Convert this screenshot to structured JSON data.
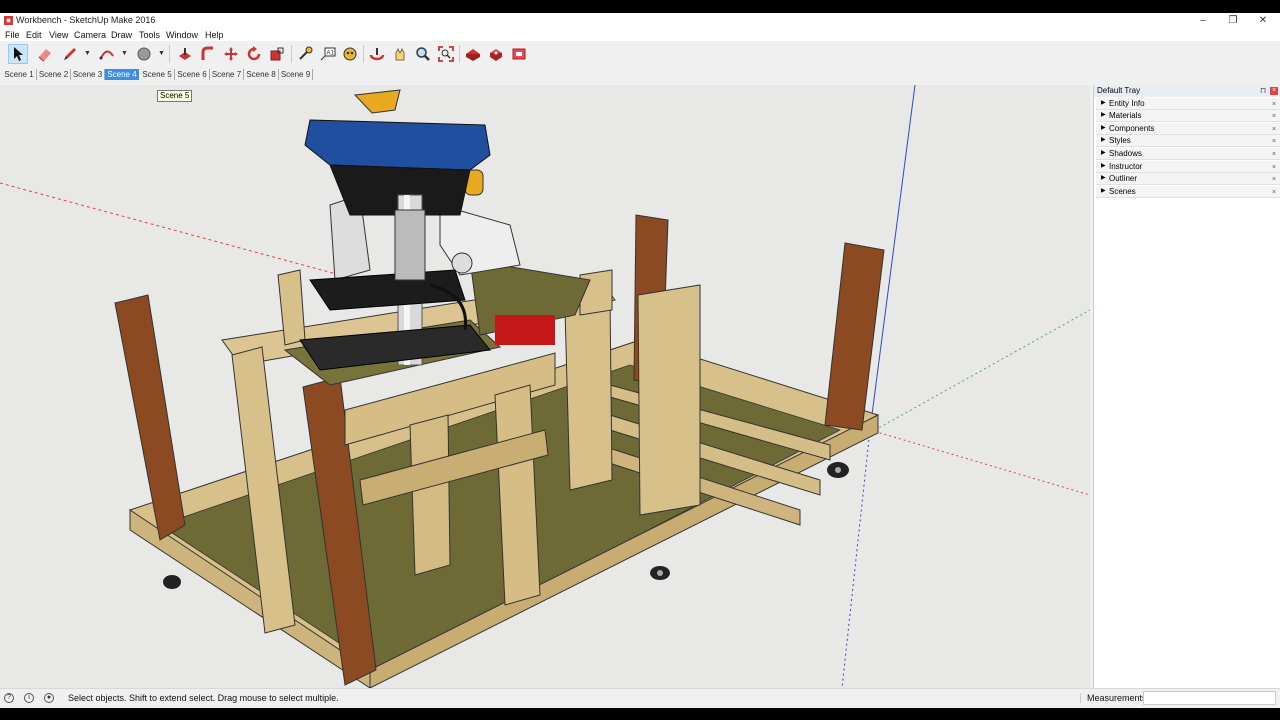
{
  "window": {
    "title": "Workbench - SketchUp Make 2016"
  },
  "menu": [
    "File",
    "Edit",
    "View",
    "Camera",
    "Draw",
    "Tools",
    "Window",
    "Help"
  ],
  "toolbar": {
    "tools": [
      "select-icon",
      "eraser-icon",
      "pencil-icon",
      "arc-icon",
      "paint-bucket-icon",
      "push-pull-icon",
      "follow-me-icon",
      "move-icon",
      "rotate-icon",
      "scale-icon",
      "tape-measure-icon",
      "text-icon",
      "walk-icon",
      "orbit-icon",
      "pan-icon",
      "zoom-icon",
      "zoom-extents-icon",
      "warehouse-icon",
      "extension-icon",
      "layout-icon"
    ]
  },
  "scenes": {
    "tabs": [
      "Scene 1",
      "Scene 2",
      "Scene 3",
      "Scene 4",
      "Scene 5",
      "Scene 6",
      "Scene 7",
      "Scene 8",
      "Scene 9"
    ],
    "active_index": 3,
    "tooltip": "Scene 5"
  },
  "tray": {
    "title": "Default Tray",
    "panels": [
      "Entity Info",
      "Materials",
      "Components",
      "Styles",
      "Shadows",
      "Instructor",
      "Outliner",
      "Scenes"
    ]
  },
  "status": {
    "hint": "Select objects. Shift to extend select. Drag mouse to select multiple.",
    "measurements_label": "Measurements",
    "measurements_value": ""
  },
  "colors": {
    "accent": "#3a8ee6",
    "wood": "#d8c08a",
    "dark_wood": "#8b4a22",
    "plywood_floor": "#6e6a36",
    "drill_blue": "#1f4f9e"
  }
}
